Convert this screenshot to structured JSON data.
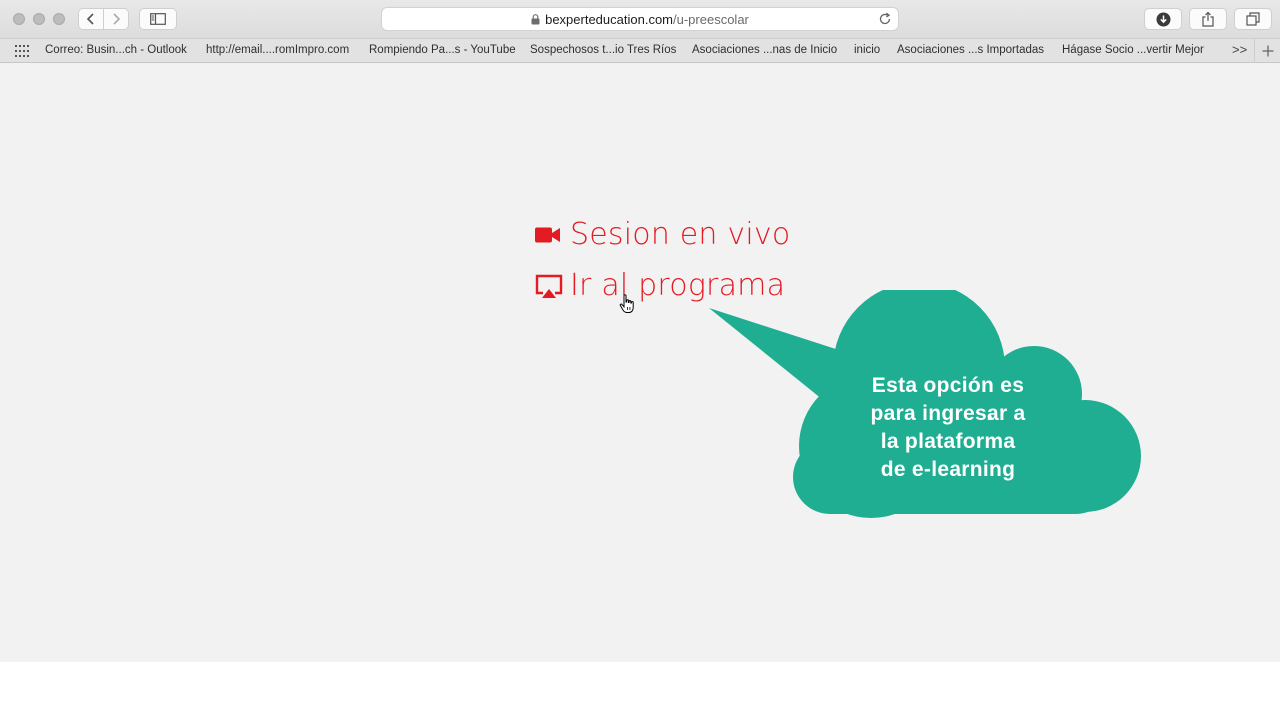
{
  "browser": {
    "url_domain": "bexperteducation.com",
    "url_path": "/u-preescolar"
  },
  "bookmarks": [
    "Correo: Busin...ch - Outlook",
    "http://email....romImpro.com",
    "Rompiendo Pa...s - YouTube",
    "Sospechosos t...io Tres Ríos",
    "Asociaciones ...nas de Inicio",
    "inicio",
    "Asociaciones ...s Importadas",
    "Hágase Socio ...vertir Mejor"
  ],
  "bookmarks_overflow": ">>",
  "page": {
    "live_session": {
      "label": "Sesion en vivo",
      "icon": "video-camera-icon"
    },
    "go_to_program": {
      "label": "Ir al programa",
      "icon": "airplay-screen-icon"
    },
    "callout": {
      "lines": [
        "Esta opción es",
        "para ingresar a",
        "la plataforma",
        "de e-learning"
      ]
    }
  },
  "colors": {
    "accent_red": "#e31b23",
    "callout_teal": "#1fae92",
    "page_bg": "#f2f2f2"
  }
}
